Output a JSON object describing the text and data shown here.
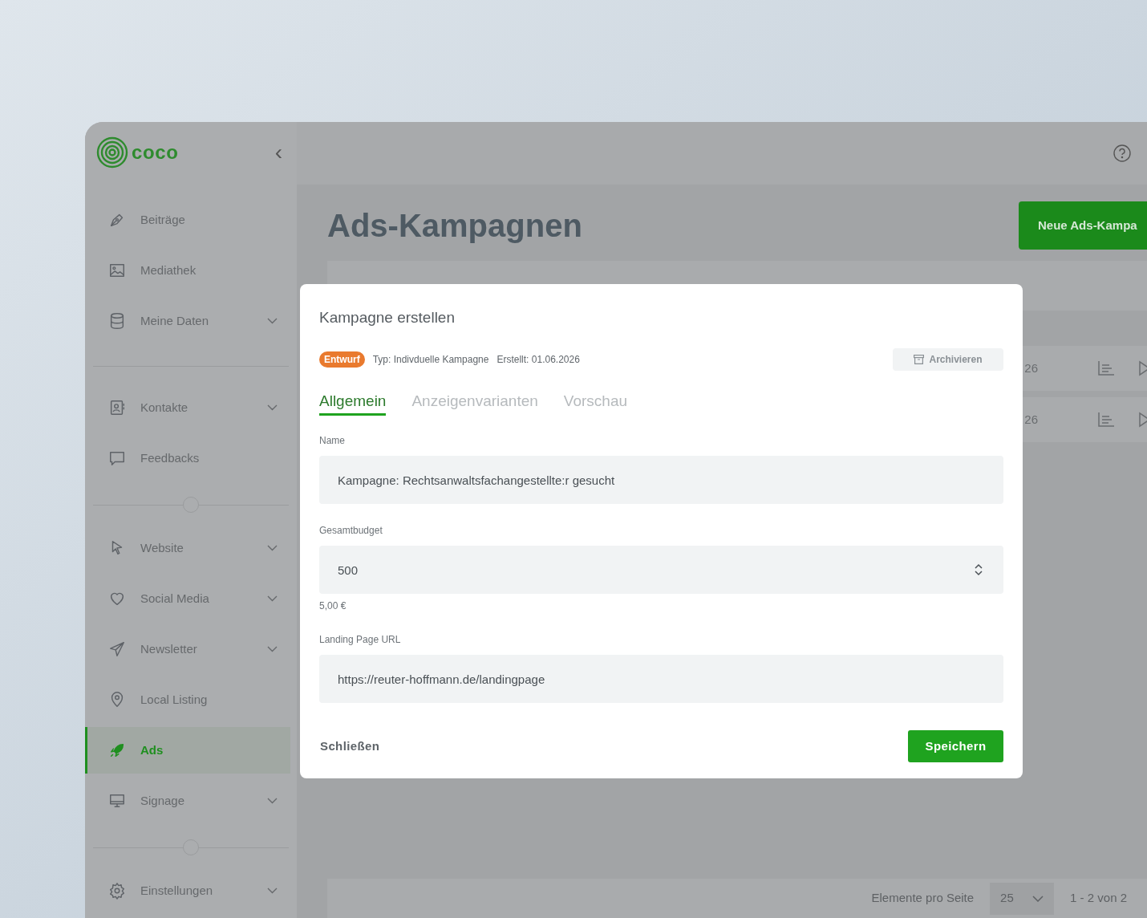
{
  "sidebar": {
    "logo": "coco",
    "collapse_icon": "‹",
    "groups": [
      [
        {
          "label": "Beiträge",
          "kind": "pen",
          "expandable": false,
          "selected": false
        },
        {
          "label": "Mediathek",
          "kind": "image",
          "expandable": false,
          "selected": false
        },
        {
          "label": "Meine Daten",
          "kind": "database",
          "expandable": true,
          "selected": false
        }
      ],
      [
        {
          "label": "Kontakte",
          "kind": "contact",
          "expandable": true,
          "selected": false
        },
        {
          "label": "Feedbacks",
          "kind": "chat",
          "expandable": false,
          "selected": false
        }
      ],
      [
        {
          "label": "Website",
          "kind": "cursor",
          "expandable": true,
          "selected": false
        },
        {
          "label": "Social Media",
          "kind": "heart",
          "expandable": true,
          "selected": false
        },
        {
          "label": "Newsletter",
          "kind": "plane",
          "expandable": true,
          "selected": false
        },
        {
          "label": "Local Listing",
          "kind": "pin",
          "expandable": false,
          "selected": false
        },
        {
          "label": "Ads",
          "kind": "rocket",
          "expandable": false,
          "selected": true
        },
        {
          "label": "Signage",
          "kind": "monitor",
          "expandable": true,
          "selected": false
        }
      ],
      [
        {
          "label": "Einstellungen",
          "kind": "gear",
          "expandable": true,
          "selected": false
        }
      ]
    ]
  },
  "page": {
    "title": "Ads-Kampagnen",
    "new_button": "Neue Ads-Kampa",
    "rows": [
      {
        "column_2": "26"
      },
      {
        "column_2": "26"
      }
    ],
    "pagination": {
      "per_page_label": "Elemente pro Seite",
      "per_page": "25",
      "range": "1 - 2 von 2"
    }
  },
  "dialog": {
    "title": "Kampagne erstellen",
    "status": "Entwurf",
    "type": "Typ: Indivduelle Kampagne",
    "created": "Erstellt: 01.06.2026",
    "archive_button": "Archivieren",
    "tabs": [
      {
        "label": "Allgemein",
        "selected": true
      },
      {
        "label": "Anzeigenvarianten",
        "selected": false
      },
      {
        "label": "Vorschau",
        "selected": false
      }
    ],
    "fields": [
      {
        "label": "Name",
        "value": "Kampagne: Rechtsanwaltsfachangestellte:r gesucht",
        "kind": "text"
      },
      {
        "label": "Gesamtbudget",
        "value": "500",
        "kind": "number",
        "hint": "5,00 €"
      },
      {
        "label": "Landing Page URL",
        "value": "https://reuter-hoffmann.de/landingpage",
        "kind": "text"
      }
    ],
    "close_button": "Schließen",
    "save_button": "Speichern"
  }
}
